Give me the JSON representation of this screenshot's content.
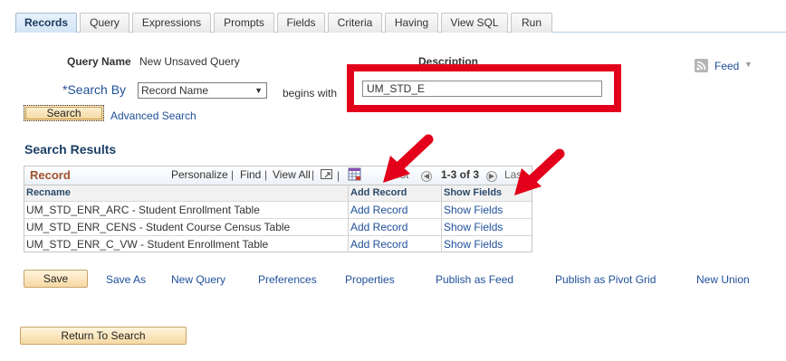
{
  "tabs": [
    "Records",
    "Query",
    "Expressions",
    "Prompts",
    "Fields",
    "Criteria",
    "Having",
    "View SQL",
    "Run"
  ],
  "query_name_label": "Query Name",
  "query_name_value": "New Unsaved Query",
  "description_label": "Description",
  "feed_label": "Feed",
  "search_by_label": "*Search By",
  "search_by_value": "Record Name",
  "begins_with_label": "begins with",
  "search_input_value": "UM_STD_E",
  "search_button": "Search",
  "advanced_search": "Advanced Search",
  "search_results_title": "Search Results",
  "grid": {
    "title": "Record",
    "personalize": "Personalize",
    "find": "Find",
    "view_all": "View All",
    "first": "First",
    "range": "1-3 of 3",
    "last": "Last",
    "columns": [
      "Recname",
      "Add Record",
      "Show Fields"
    ],
    "rows": [
      {
        "recname": "UM_STD_ENR_ARC - Student Enrollment Table",
        "add": "Add Record",
        "show": "Show Fields"
      },
      {
        "recname": "UM_STD_ENR_CENS - Student Course Census  Table",
        "add": "Add Record",
        "show": "Show Fields"
      },
      {
        "recname": "UM_STD_ENR_C_VW - Student Enrollment Table",
        "add": "Add Record",
        "show": "Show Fields"
      }
    ]
  },
  "toolbar": {
    "save": "Save",
    "save_as": "Save As",
    "new_query": "New Query",
    "preferences": "Preferences",
    "properties": "Properties",
    "publish_feed": "Publish as Feed",
    "publish_pivot": "Publish as Pivot Grid",
    "new_union": "New Union"
  },
  "return_to_search": "Return To Search",
  "colors": {
    "highlight_red": "#e2001a",
    "link_blue": "#1f4f99",
    "grid_title": "#a0522d"
  },
  "icons": [
    "feed-icon",
    "dropdown-arrow-icon",
    "new-window-icon",
    "download-grid-icon",
    "previous-icon",
    "next-icon",
    "annotation-arrow-icon"
  ]
}
